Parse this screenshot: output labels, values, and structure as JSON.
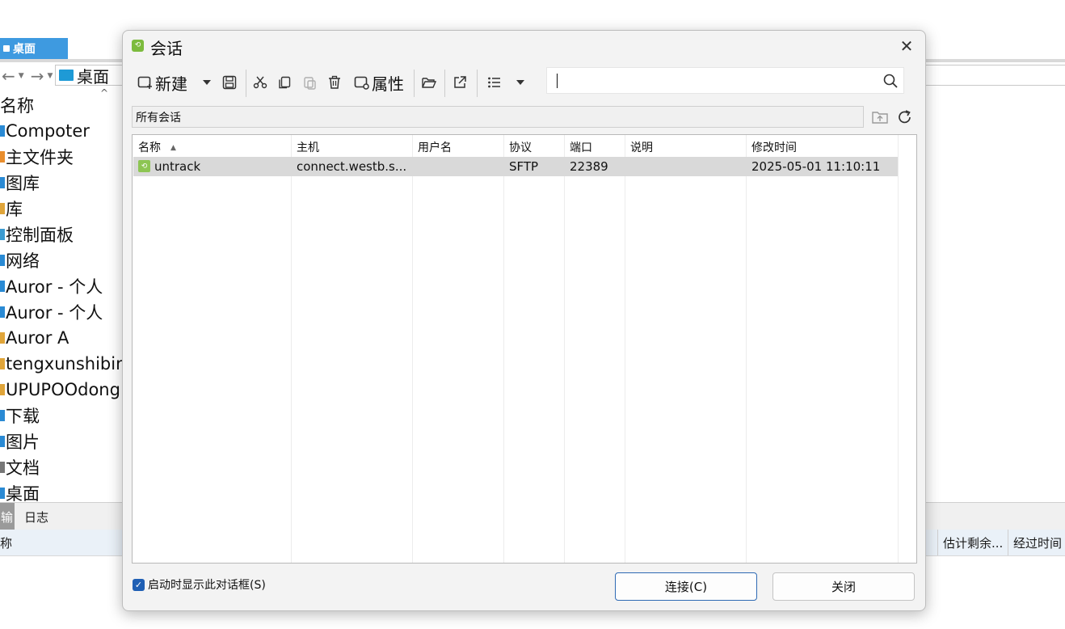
{
  "background": {
    "tab_label": "桌面",
    "address_text": "桌面",
    "column_name_header": "名称",
    "items": [
      {
        "label": "Compoter",
        "color": "#2a8ad4"
      },
      {
        "label": "主文件夹",
        "color": "#e98e2e"
      },
      {
        "label": "图库",
        "color": "#2a8ad4"
      },
      {
        "label": "库",
        "color": "#e0a53a"
      },
      {
        "label": "控制面板",
        "color": "#3b9bd1"
      },
      {
        "label": "网络",
        "color": "#2a8ad4"
      },
      {
        "label": "Auror - 个人",
        "color": "#2a8ad4"
      },
      {
        "label": "Auror - 个人",
        "color": "#2a8ad4"
      },
      {
        "label": "Auror A",
        "color": "#e0a53a"
      },
      {
        "label": "tengxunshibin",
        "color": "#e0a53a"
      },
      {
        "label": "UPUPOOdong",
        "color": "#e0a53a"
      },
      {
        "label": "下载",
        "color": "#2a8ad4"
      },
      {
        "label": "图片",
        "color": "#2a8ad4"
      },
      {
        "label": "文档",
        "color": "#777777"
      },
      {
        "label": "桌面",
        "color": "#2a8ad4"
      }
    ],
    "lower_tabs": [
      "输",
      "日志"
    ],
    "lower_headers": {
      "left": "称",
      "estimate": "估计剩余...",
      "elapsed": "经过时间"
    }
  },
  "dialog": {
    "title": "会话",
    "toolbar": {
      "new_label": "新建",
      "properties_label": "属性"
    },
    "search": {
      "value": "",
      "placeholder": ""
    },
    "folder_path": "所有会话",
    "columns": [
      "名称",
      "主机",
      "用户名",
      "协议",
      "端口",
      "说明",
      "修改时间"
    ],
    "sessions": [
      {
        "name": "untrack",
        "host": "connect.westb.s...",
        "user": "",
        "protocol": "SFTP",
        "port": "22389",
        "description": "",
        "modified": "2025-05-01 11:10:11"
      }
    ],
    "startup_checkbox_label": "启动时显示此对话框(S)",
    "startup_checked": true,
    "connect_button": "连接(C)",
    "close_button": "关闭"
  },
  "colors": {
    "accent": "#1f5fb4",
    "session_icon": "#8dc553",
    "selected_row": "#d9d9d9"
  }
}
